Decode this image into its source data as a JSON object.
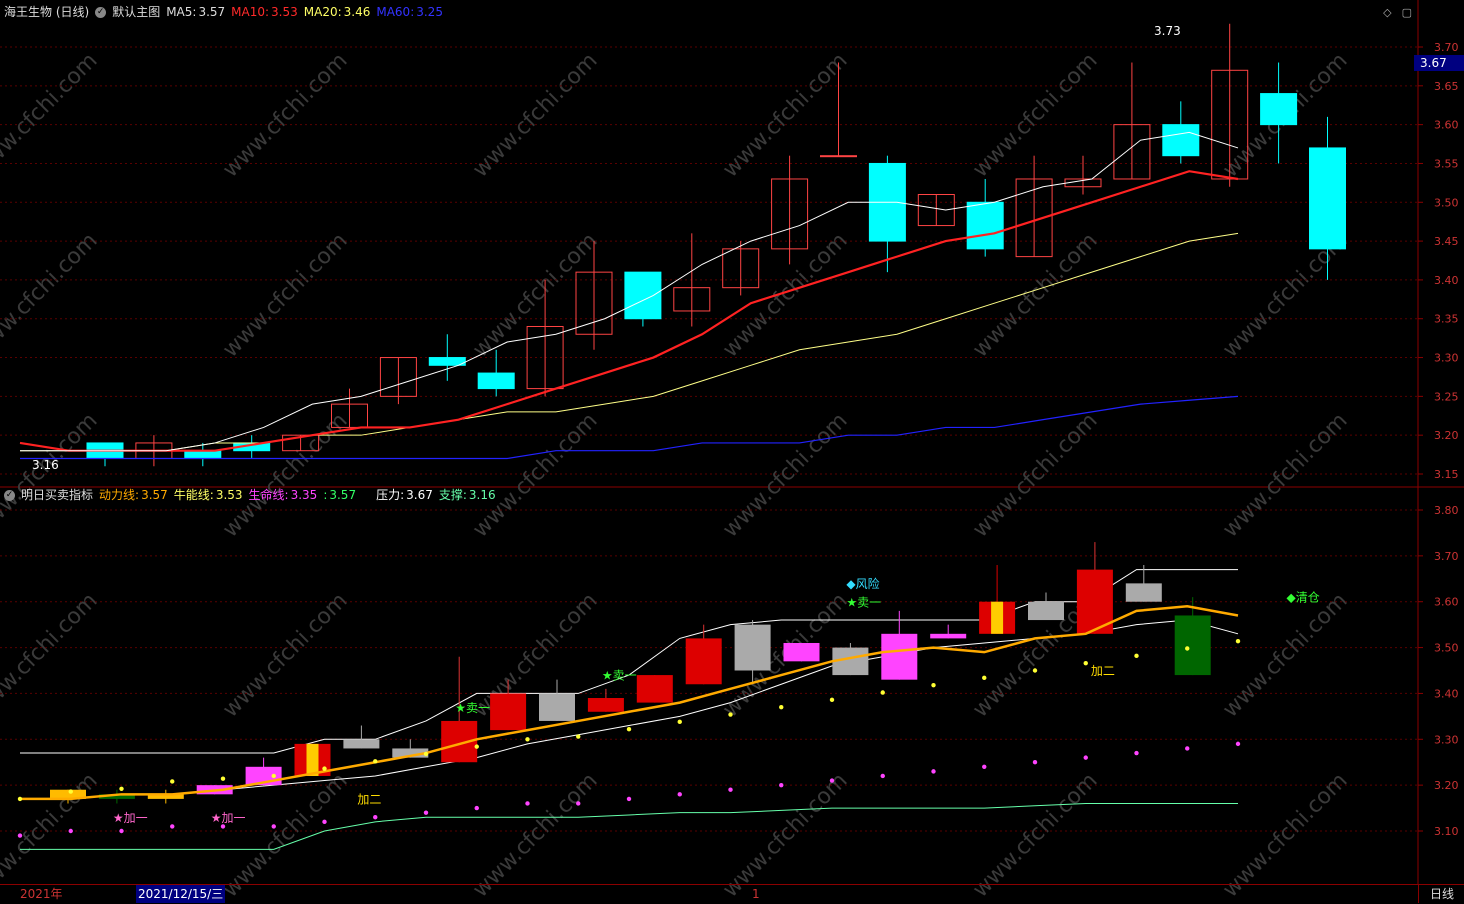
{
  "top_header": {
    "title": "海王生物 (日线)",
    "view": "默认主图",
    "ma5": {
      "label": "MA5:",
      "value": "3.57",
      "color": "#ffffff"
    },
    "ma10": {
      "label": "MA10:",
      "value": "3.53",
      "color": "#ff2a2a"
    },
    "ma20": {
      "label": "MA20:",
      "value": "3.46",
      "color": "#ffff66"
    },
    "ma60": {
      "label": "MA60:",
      "value": "3.25",
      "color": "#2222ff"
    }
  },
  "bottom_header": {
    "title": "明日买卖指标",
    "dongli": {
      "label": "动力线:",
      "value": "3.57",
      "color": "#ffaa00"
    },
    "nengneng": {
      "label": "牛能线:",
      "value": "3.53",
      "color": "#ffff66"
    },
    "shengming": {
      "label": "生命线:",
      "value": "3.35",
      "color": "#ff44ff"
    },
    "blank": {
      "label": ":",
      "value": "3.57",
      "color": "#33ff66"
    },
    "yali": {
      "label": "压力:",
      "value": "3.67",
      "color": "#ffffff"
    },
    "zhicheng": {
      "label": "支撑:",
      "value": "3.16",
      "color": "#66ffaa"
    }
  },
  "watermark": "www.cfchi.com",
  "current_price_tag": "3.67",
  "bottom_bar": {
    "year": "2021年",
    "date": "2021/12/15/三",
    "tick": "1",
    "period": "日线"
  },
  "chart_data": [
    {
      "type": "candlestick",
      "name": "main",
      "ylim": [
        3.13,
        3.75
      ],
      "yticks": [
        "3.70",
        "3.65",
        "3.60",
        "3.55",
        "3.50",
        "3.45",
        "3.40",
        "3.35",
        "3.30",
        "3.25",
        "3.20",
        "3.15"
      ],
      "ohlc": [
        [
          3.19,
          3.19,
          3.16,
          3.17
        ],
        [
          3.17,
          3.2,
          3.16,
          3.19
        ],
        [
          3.18,
          3.19,
          3.16,
          3.17
        ],
        [
          3.19,
          3.2,
          3.17,
          3.18
        ],
        [
          3.18,
          3.2,
          3.18,
          3.2
        ],
        [
          3.21,
          3.26,
          3.21,
          3.24
        ],
        [
          3.25,
          3.3,
          3.24,
          3.3
        ],
        [
          3.3,
          3.33,
          3.27,
          3.29
        ],
        [
          3.28,
          3.31,
          3.25,
          3.26
        ],
        [
          3.26,
          3.4,
          3.25,
          3.34
        ],
        [
          3.33,
          3.45,
          3.31,
          3.41
        ],
        [
          3.41,
          3.41,
          3.34,
          3.35
        ],
        [
          3.36,
          3.46,
          3.34,
          3.39
        ],
        [
          3.39,
          3.45,
          3.38,
          3.44
        ],
        [
          3.44,
          3.56,
          3.42,
          3.53
        ],
        [
          3.56,
          3.68,
          3.56,
          3.56
        ],
        [
          3.55,
          3.56,
          3.41,
          3.45
        ],
        [
          3.47,
          3.51,
          3.47,
          3.51
        ],
        [
          3.5,
          3.53,
          3.43,
          3.44
        ],
        [
          3.43,
          3.56,
          3.43,
          3.53
        ],
        [
          3.52,
          3.56,
          3.51,
          3.53
        ],
        [
          3.53,
          3.68,
          3.53,
          3.6
        ],
        [
          3.6,
          3.63,
          3.55,
          3.56
        ],
        [
          3.53,
          3.73,
          3.52,
          3.67
        ],
        [
          3.64,
          3.68,
          3.55,
          3.6
        ],
        [
          3.57,
          3.61,
          3.4,
          3.44
        ]
      ],
      "ma5": [
        3.18,
        3.18,
        3.18,
        3.18,
        3.19,
        3.21,
        3.24,
        3.25,
        3.27,
        3.29,
        3.32,
        3.33,
        3.35,
        3.38,
        3.42,
        3.45,
        3.47,
        3.5,
        3.5,
        3.49,
        3.5,
        3.52,
        3.53,
        3.58,
        3.59,
        3.57
      ],
      "ma10": [
        3.19,
        3.18,
        3.18,
        3.18,
        3.18,
        3.19,
        3.2,
        3.21,
        3.21,
        3.22,
        3.24,
        3.26,
        3.28,
        3.3,
        3.33,
        3.37,
        3.39,
        3.41,
        3.43,
        3.45,
        3.46,
        3.48,
        3.5,
        3.52,
        3.54,
        3.53
      ],
      "ma20": [
        3.18,
        3.18,
        3.18,
        3.18,
        3.19,
        3.19,
        3.2,
        3.2,
        3.21,
        3.22,
        3.23,
        3.23,
        3.24,
        3.25,
        3.27,
        3.29,
        3.31,
        3.32,
        3.33,
        3.35,
        3.37,
        3.39,
        3.41,
        3.43,
        3.45,
        3.46
      ],
      "ma60": [
        3.17,
        3.17,
        3.17,
        3.17,
        3.17,
        3.17,
        3.17,
        3.17,
        3.17,
        3.17,
        3.17,
        3.18,
        3.18,
        3.18,
        3.19,
        3.19,
        3.19,
        3.2,
        3.2,
        3.21,
        3.21,
        3.22,
        3.23,
        3.24,
        3.245,
        3.25
      ],
      "max_label": "3.73",
      "min_label": "3.16"
    },
    {
      "type": "indicator",
      "name": "明日买卖指标",
      "ylim": [
        3.03,
        3.83
      ],
      "yticks": [
        "3.80",
        "3.70",
        "3.60",
        "3.50",
        "3.40",
        "3.30",
        "3.20",
        "3.10"
      ],
      "candles": [
        [
          3.17,
          3.19,
          3.16,
          3.19,
          "yellow"
        ],
        [
          3.17,
          3.19,
          3.16,
          3.18,
          "green"
        ],
        [
          3.17,
          3.19,
          3.16,
          3.18,
          "yellow"
        ],
        [
          3.18,
          3.2,
          3.18,
          3.2,
          "magenta"
        ],
        [
          3.2,
          3.26,
          3.2,
          3.24,
          "magenta"
        ],
        [
          3.22,
          3.29,
          3.22,
          3.29,
          "redyellow"
        ],
        [
          3.28,
          3.33,
          3.28,
          3.3,
          "grey"
        ],
        [
          3.26,
          3.3,
          3.26,
          3.28,
          "grey"
        ],
        [
          3.25,
          3.48,
          3.25,
          3.34,
          "red"
        ],
        [
          3.32,
          3.43,
          3.32,
          3.4,
          "red"
        ],
        [
          3.34,
          3.43,
          3.34,
          3.4,
          "grey"
        ],
        [
          3.36,
          3.41,
          3.36,
          3.39,
          "red"
        ],
        [
          3.38,
          3.44,
          3.38,
          3.44,
          "red"
        ],
        [
          3.42,
          3.55,
          3.42,
          3.52,
          "red"
        ],
        [
          3.45,
          3.56,
          3.42,
          3.55,
          "grey"
        ],
        [
          3.47,
          3.51,
          3.47,
          3.51,
          "magenta"
        ],
        [
          3.44,
          3.51,
          3.44,
          3.5,
          "grey"
        ],
        [
          3.43,
          3.58,
          3.43,
          3.53,
          "magenta"
        ],
        [
          3.52,
          3.55,
          3.52,
          3.53,
          "magenta"
        ],
        [
          3.53,
          3.68,
          3.53,
          3.6,
          "redyellow"
        ],
        [
          3.56,
          3.62,
          3.56,
          3.6,
          "grey"
        ],
        [
          3.53,
          3.73,
          3.53,
          3.67,
          "red"
        ],
        [
          3.6,
          3.68,
          3.6,
          3.64,
          "grey"
        ],
        [
          3.44,
          3.61,
          3.44,
          3.57,
          "green"
        ]
      ],
      "dongli": [
        3.17,
        3.17,
        3.18,
        3.18,
        3.19,
        3.21,
        3.23,
        3.25,
        3.27,
        3.3,
        3.32,
        3.34,
        3.36,
        3.38,
        3.41,
        3.44,
        3.47,
        3.49,
        3.5,
        3.49,
        3.52,
        3.53,
        3.58,
        3.59,
        3.57
      ],
      "niuneng": [
        3.17,
        3.17,
        3.18,
        3.18,
        3.19,
        3.2,
        3.21,
        3.22,
        3.24,
        3.26,
        3.29,
        3.31,
        3.33,
        3.35,
        3.38,
        3.42,
        3.46,
        3.48,
        3.5,
        3.51,
        3.52,
        3.53,
        3.55,
        3.56,
        3.53
      ],
      "shengming": [
        3.15,
        3.16,
        3.16,
        3.17,
        3.17,
        3.17,
        3.18,
        3.19,
        3.2,
        3.21,
        3.22,
        3.22,
        3.23,
        3.24,
        3.25,
        3.26,
        3.27,
        3.28,
        3.29,
        3.3,
        3.31,
        3.32,
        3.33,
        3.34,
        3.35
      ],
      "yali": [
        3.27,
        3.27,
        3.27,
        3.27,
        3.27,
        3.27,
        3.3,
        3.3,
        3.34,
        3.4,
        3.4,
        3.4,
        3.44,
        3.52,
        3.55,
        3.56,
        3.56,
        3.56,
        3.56,
        3.56,
        3.6,
        3.6,
        3.67,
        3.67,
        3.67
      ],
      "zhicheng": [
        3.06,
        3.06,
        3.06,
        3.06,
        3.06,
        3.06,
        3.1,
        3.12,
        3.13,
        3.13,
        3.13,
        3.13,
        3.135,
        3.14,
        3.14,
        3.145,
        3.15,
        3.15,
        3.15,
        3.15,
        3.155,
        3.16,
        3.16,
        3.16,
        3.16
      ],
      "signals": [
        {
          "i": 1,
          "y": 3.12,
          "text": "★加一",
          "color": "#ff66cc"
        },
        {
          "i": 3,
          "y": 3.12,
          "text": "★加一",
          "color": "#ff66cc"
        },
        {
          "i": 6,
          "y": 3.16,
          "text": "加二",
          "color": "#ffdd00"
        },
        {
          "i": 8,
          "y": 3.36,
          "text": "★卖一",
          "color": "#33ff33"
        },
        {
          "i": 11,
          "y": 3.43,
          "text": "★卖一",
          "color": "#33ff33"
        },
        {
          "i": 16,
          "y": 3.59,
          "text": "★卖一",
          "color": "#33ff33"
        },
        {
          "i": 16,
          "y": 3.63,
          "text": "◆风险",
          "color": "#33ddff"
        },
        {
          "i": 21,
          "y": 3.44,
          "text": "加二",
          "color": "#ffdd00"
        },
        {
          "i": 25,
          "y": 3.6,
          "text": "◆清仓",
          "color": "#33ff33"
        }
      ]
    }
  ]
}
